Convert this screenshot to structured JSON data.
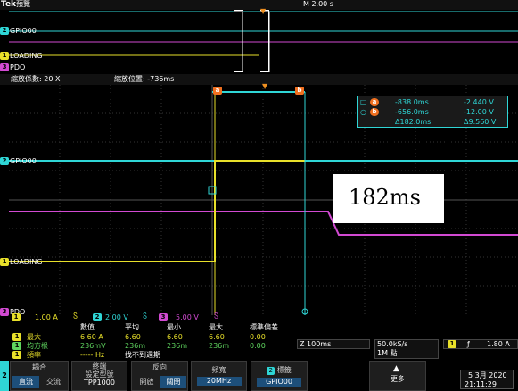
{
  "header": {
    "brand": "Tek",
    "mode": "預覽",
    "timebase": "M 2.00 s"
  },
  "overview": {
    "ch2": "GPIO00",
    "ch1": "LOADING",
    "ch3": "PDO"
  },
  "zoom": {
    "factor": "縮放係數: 20 X",
    "position": "縮放位置: -736ms"
  },
  "cursors": {
    "a_label": "a",
    "b_label": "b",
    "a_time": "-838.0ms",
    "a_volt": "-2.440 V",
    "b_time": "-656.0ms",
    "b_volt": "-12.00 V",
    "dt": "Δ182.0ms",
    "dv": "Δ9.560 V"
  },
  "annotation": "182ms",
  "traces": {
    "ch2": "GPIO00",
    "ch1": "LOADING",
    "ch3": "PDO"
  },
  "channels": {
    "ch1_num": "1",
    "ch1_scale": "1.00 A",
    "ch2_num": "2",
    "ch2_scale": "2.00 V",
    "ch3_num": "3",
    "ch3_scale": "5.00 V"
  },
  "meas": {
    "headers": [
      "數值",
      "平均",
      "最小",
      "最大",
      "標準偏差"
    ],
    "rows": [
      {
        "num": "1",
        "name": "最大",
        "vals": [
          "6.60 A",
          "6.60",
          "6.60",
          "6.60",
          "0.00"
        ]
      },
      {
        "num": "1",
        "name": "均方根",
        "vals": [
          "236mV",
          "236m",
          "236m",
          "236m",
          "0.00"
        ]
      },
      {
        "num": "1",
        "name": "頻率",
        "vals": [
          "----- Hz",
          "找不到週期",
          "",
          "",
          ""
        ]
      }
    ]
  },
  "acq": {
    "horiz": "Z 100ms",
    "rate": "50.0kS/s",
    "length": "1M 點",
    "trig_ch": "1",
    "trig_level": "1.80 A"
  },
  "menu": {
    "ch": "2",
    "coupling_label": "耦合",
    "coupling_a": "直流",
    "coupling_b": "交流",
    "term_label": "終端",
    "term_sub": "設定型號",
    "term_val": "TPP1000",
    "inv_label": "反向",
    "inv_a": "開啟",
    "inv_b": "關閉",
    "bw_label": "頻寬",
    "bw_val": "20MHz",
    "lbl_num": "2",
    "lbl_label": "標籤",
    "lbl_val": "GPIO00",
    "more": "更多",
    "date": "5 3月 2020",
    "time": "21:11:29"
  },
  "colors": {
    "ch1": "#e8e02a",
    "ch2": "#2fd6d6",
    "ch3": "#d24ad2",
    "math": "#5fd65f"
  }
}
